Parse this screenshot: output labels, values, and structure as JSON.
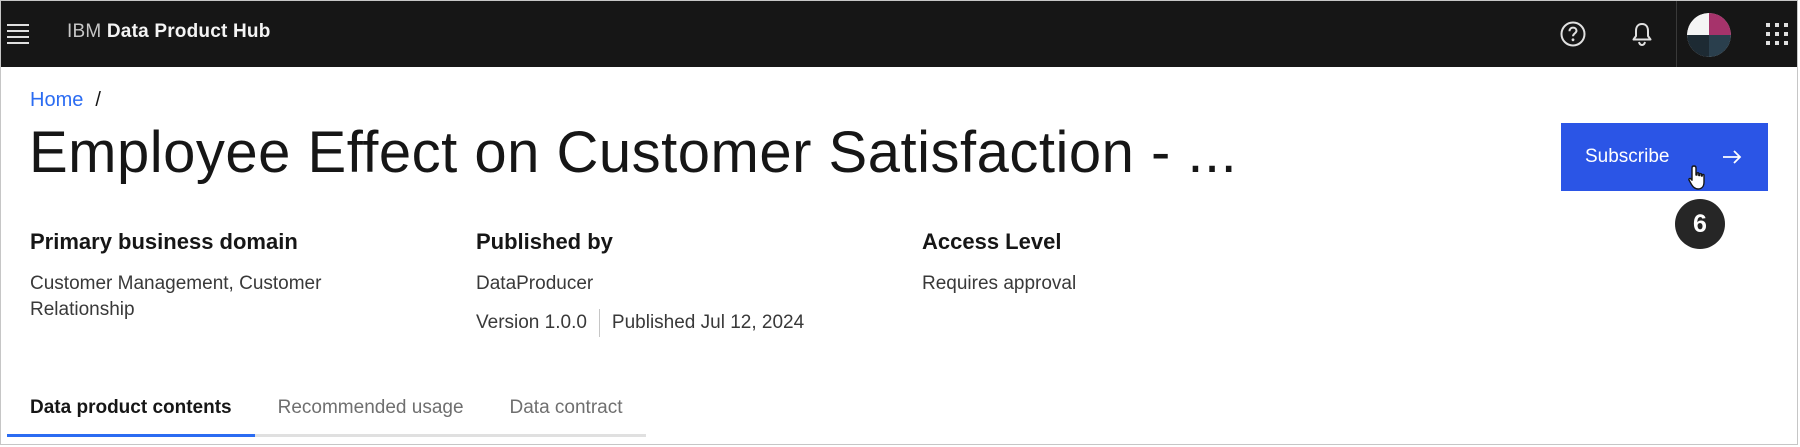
{
  "header": {
    "brand_prefix": "IBM",
    "brand_name": "Data Product Hub",
    "icons": [
      "menu-icon",
      "help-icon",
      "notification-bell-icon",
      "avatar",
      "app-switcher-icon"
    ]
  },
  "breadcrumb": {
    "home": "Home",
    "separator": "/"
  },
  "page": {
    "title": "Employee Effect on Customer Satisfaction - ..."
  },
  "actions": {
    "subscribe_label": "Subscribe",
    "subscribe_icon": "arrow-right-icon",
    "step_badge": "6"
  },
  "meta": {
    "domain_label": "Primary business domain",
    "domain_value": "Customer Management, Customer Relationship",
    "published_label": "Published by",
    "published_value": "DataProducer",
    "version": "Version 1.0.0",
    "published_date": "Published Jul 12, 2024",
    "access_label": "Access Level",
    "access_value": "Requires approval"
  },
  "tabs": [
    {
      "label": "Data product contents",
      "active": true
    },
    {
      "label": "Recommended usage",
      "active": false
    },
    {
      "label": "Data contract",
      "active": false
    }
  ],
  "colors": {
    "header_bg": "#161616",
    "primary_button": "#2b55e6",
    "link": "#2b6cf2",
    "active_tab_indicator": "#2b6cf2"
  }
}
